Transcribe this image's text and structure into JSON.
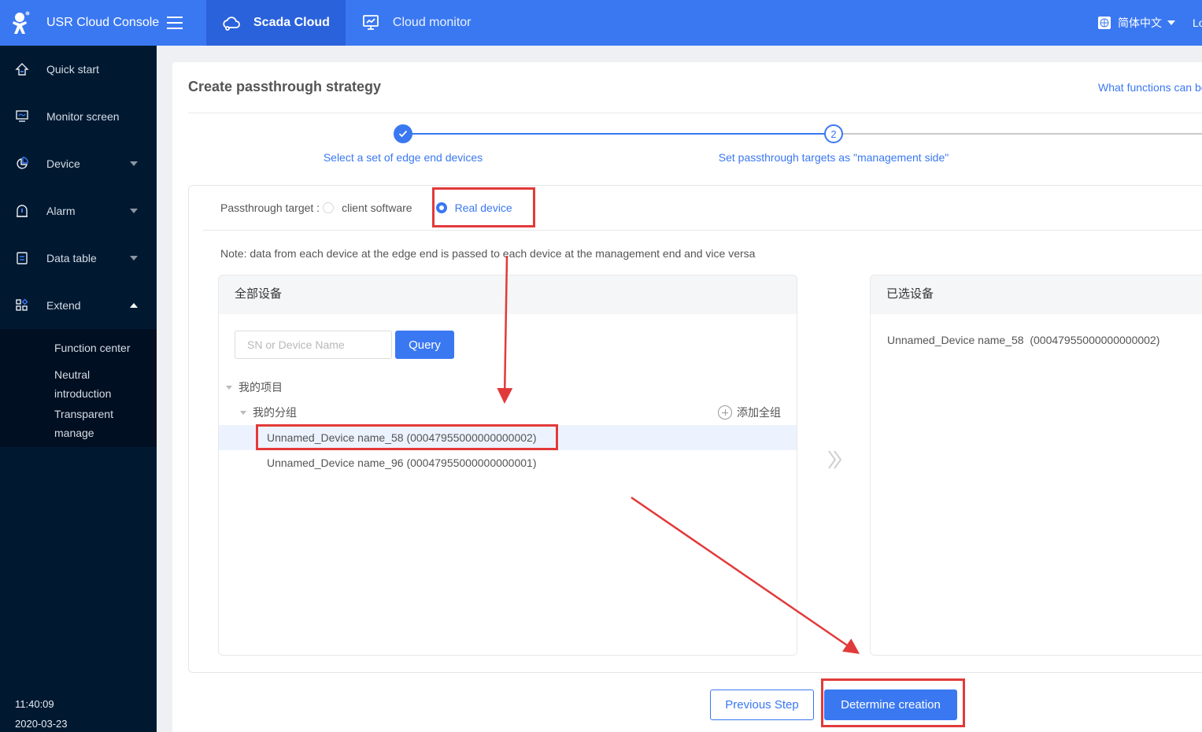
{
  "topbar": {
    "brand_title": "USR Cloud Console",
    "tabs": [
      {
        "label": "Scada Cloud",
        "icon": "cloud-icon",
        "active": true
      },
      {
        "label": "Cloud monitor",
        "icon": "monitor-chart-icon",
        "active": false
      }
    ],
    "language": "简体中文",
    "logout_label": "Lo"
  },
  "sidebar": {
    "items": [
      {
        "label": "Quick start",
        "icon": "home-icon",
        "expandable": false
      },
      {
        "label": "Monitor screen",
        "icon": "monitor-icon",
        "expandable": false
      },
      {
        "label": "Device",
        "icon": "pie-chart-icon",
        "expandable": true
      },
      {
        "label": "Alarm",
        "icon": "alarm-icon",
        "expandable": true
      },
      {
        "label": "Data table",
        "icon": "table-icon",
        "expandable": true
      },
      {
        "label": "Extend",
        "icon": "apps-icon",
        "expandable": true,
        "expanded": true
      }
    ],
    "submenu": [
      "Function center",
      "Neutral introduction",
      "Transparent manage"
    ],
    "time": "11:40:09",
    "date": "2020-03-23"
  },
  "page": {
    "title": "Create passthrough strategy",
    "help_link": "What functions can be",
    "steps": [
      {
        "number": "1",
        "label": "Select a set of edge end devices",
        "status": "done"
      },
      {
        "number": "2",
        "label": "Set passthrough targets as \"management side\"",
        "status": "current"
      }
    ],
    "target_label": "Passthrough target :",
    "target_options": [
      {
        "label": "client software",
        "checked": false
      },
      {
        "label": "Real device",
        "checked": true
      }
    ],
    "note": "Note: data from each device at the edge end is passed to each device at the management end and vice versa",
    "all_devices": {
      "title": "全部设备",
      "search_placeholder": "SN or Device Name",
      "search_value": "",
      "query_label": "Query",
      "project": "我的项目",
      "group": "我的分组",
      "add_group_label": "添加全组",
      "devices": [
        {
          "label": "Unnamed_Device name_58 (00047955000000000002)",
          "selected": true
        },
        {
          "label": "Unnamed_Device name_96 (00047955000000000001)",
          "selected": false
        }
      ]
    },
    "selected_devices": {
      "title": "已选设备",
      "items": [
        "Unnamed_Device name_58  (00047955000000000002)"
      ]
    },
    "prev_label": "Previous Step",
    "create_label": "Determine creation"
  },
  "colors": {
    "primary": "#3a78f2",
    "sidebar_bg": "#001931",
    "annotation": "#e23a3a"
  }
}
